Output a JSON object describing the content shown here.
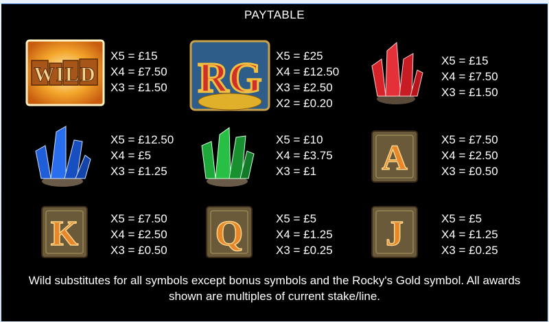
{
  "title": "PAYTABLE",
  "symbols": [
    {
      "name": "wild",
      "label": "WILD",
      "pays": [
        "X5 = £15",
        "X4 = £7.50",
        "X3 = £1.50"
      ]
    },
    {
      "name": "rg",
      "label": "RG",
      "pays": [
        "X5 = £25",
        "X4 = £12.50",
        "X3 = £2.50",
        "X2 = £0.20"
      ]
    },
    {
      "name": "red-crystal",
      "pays": [
        "X5 = £15",
        "X4 = £7.50",
        "X3 = £1.50"
      ]
    },
    {
      "name": "blue-crystal",
      "pays": [
        "X5 = £12.50",
        "X4 = £5",
        "X3 = £1.25"
      ]
    },
    {
      "name": "green-crystal",
      "pays": [
        "X5 = £10",
        "X4 = £3.75",
        "X3 = £1"
      ]
    },
    {
      "name": "a",
      "label": "A",
      "pays": [
        "X5 = £7.50",
        "X4 = £2.50",
        "X3 = £0.50"
      ]
    },
    {
      "name": "k",
      "label": "K",
      "pays": [
        "X5 = £7.50",
        "X4 = £2.50",
        "X3 = £0.50"
      ]
    },
    {
      "name": "q",
      "label": "Q",
      "pays": [
        "X5 = £5",
        "X4 = £1.25",
        "X3 = £0.25"
      ]
    },
    {
      "name": "j",
      "label": "J",
      "pays": [
        "X5 = £5",
        "X4 = £1.25",
        "X3 = £0.25"
      ]
    }
  ],
  "footer": "Wild substitutes for all symbols except bonus symbols and the Rocky's Gold symbol. All awards shown are multiples of current stake/line.",
  "colors": {
    "background": "#000000",
    "text": "#ffffff",
    "gold": "#e8a63a",
    "red_crystal": "#d8222a",
    "blue_crystal": "#1f5ed8",
    "green_crystal": "#1fa83a"
  }
}
